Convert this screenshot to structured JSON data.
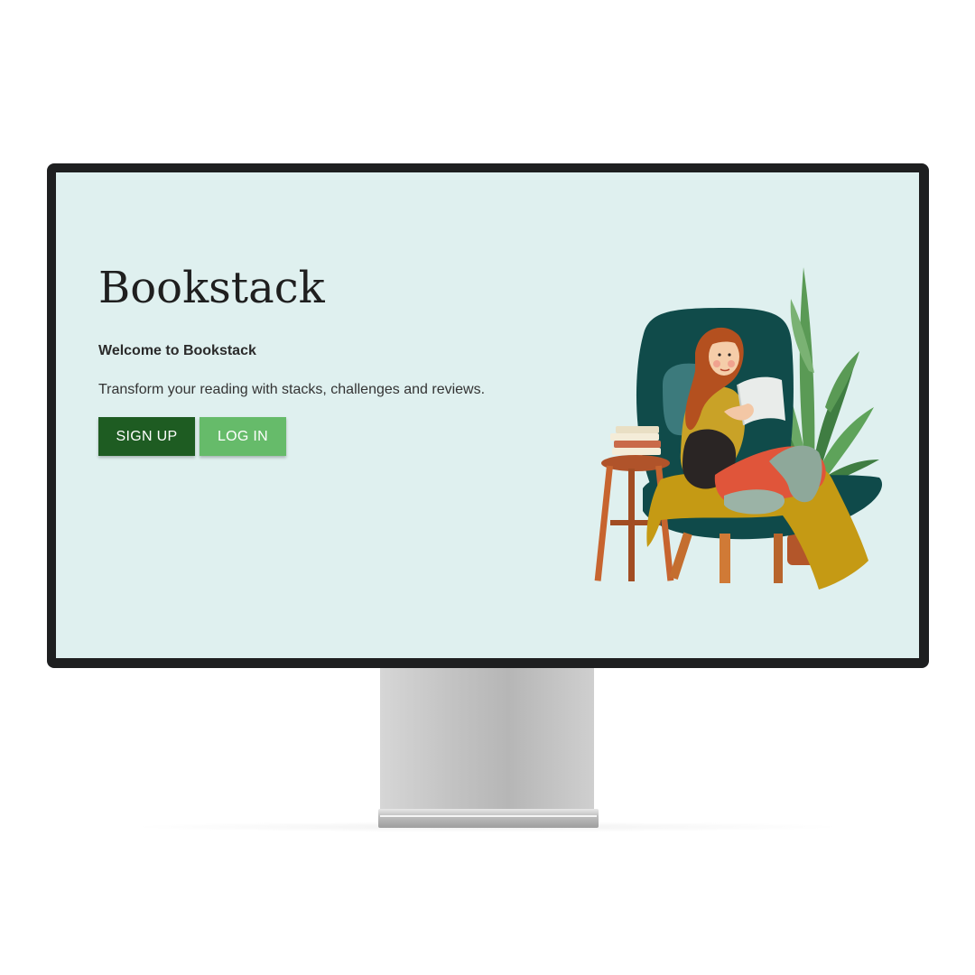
{
  "app": {
    "title": "Bookstack",
    "welcome": "Welcome to Bookstack",
    "tagline": "Transform your reading with stacks, challenges and reviews."
  },
  "actions": {
    "signup_label": "SIGN UP",
    "login_label": "LOG IN"
  },
  "colors": {
    "screen_background": "#dff0ef",
    "signup_button": "#1e5c22",
    "login_button": "#66bb6a",
    "bezel": "#1e1f20"
  },
  "illustration": {
    "icon": "woman-reading-in-armchair-illustration"
  }
}
